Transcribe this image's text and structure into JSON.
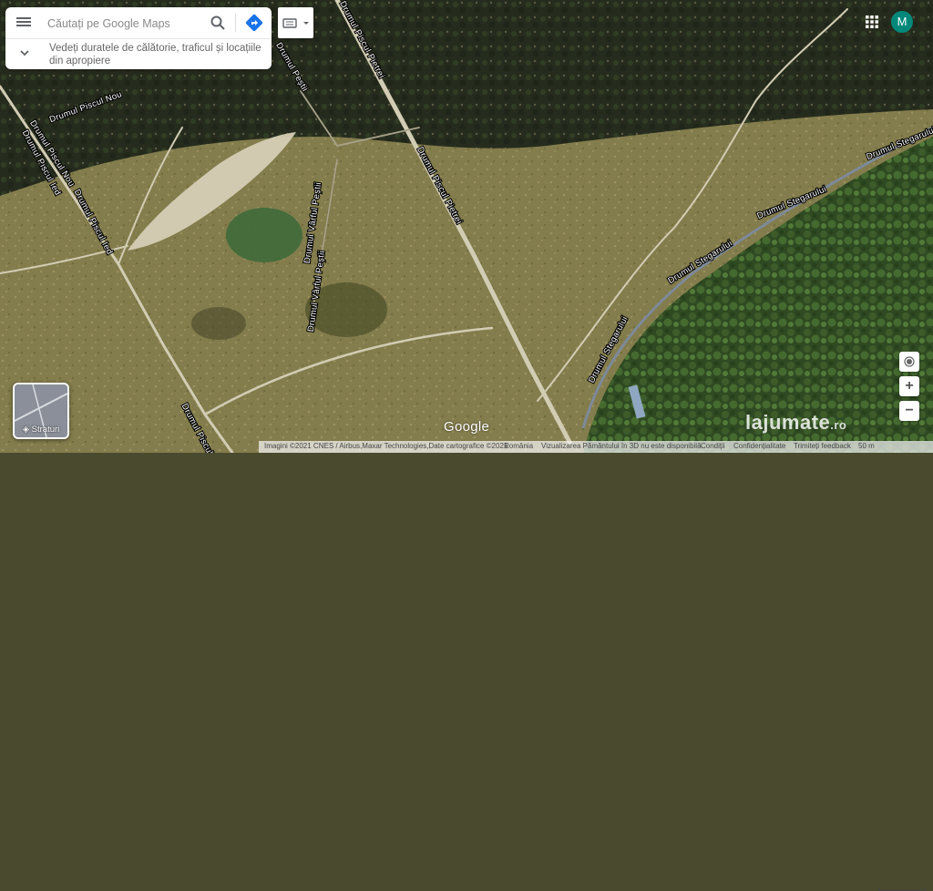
{
  "search": {
    "placeholder": "Căutați pe Google Maps",
    "expand_text": "Vedeți duratele de călătorie, traficul și locațiile din apropiere"
  },
  "user": {
    "avatar_letter": "M"
  },
  "layers": {
    "label": "Straturi"
  },
  "map": {
    "road_labels": [
      "Drumul Piscul Pietrei",
      "Drumul Piscul Nou",
      "Drumul Piscul Nou",
      "Drumul Peștii",
      "Drumul Piscul Ied",
      "Drumul Piscul Ied",
      "Drumul Vârful Peștii",
      "Drumul Vârful Peștii",
      "Drumul Piscul Pietrei",
      "Drumul Stegarului",
      "Drumul Stegarului",
      "Drumul Stegarului",
      "Drumul Stegarului",
      "Drumul Piscul Ied"
    ]
  },
  "branding": {
    "google_logo": "Google",
    "watermark": "lajumate",
    "watermark_suffix": ".ro"
  },
  "footer": {
    "imagery": "Imagini ©2021 CNES / Airbus,Maxar Technologies,Date cartografice ©2021",
    "country": "România",
    "view3d": "Vizualizarea Pământului în 3D nu este disponibilă",
    "terms": "Condiții",
    "privacy": "Confidențialitate",
    "feedback": "Trimiteți feedback",
    "scale": "50 m"
  },
  "colors": {
    "avatar": "#00897b",
    "directions": "#1a73e8"
  }
}
